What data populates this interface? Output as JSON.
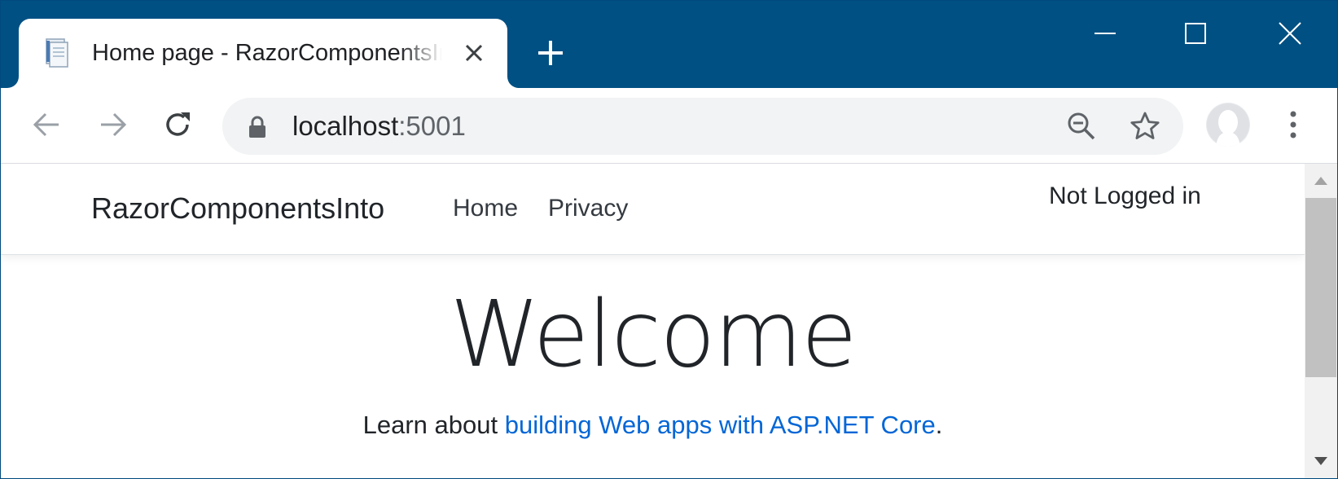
{
  "window": {
    "tab_title": "Home page - RazorComponentsInto",
    "controls": {
      "minimize": "minimize-icon",
      "maximize": "maximize-icon",
      "close": "close-icon"
    }
  },
  "toolbar": {
    "url_host": "localhost",
    "url_port": ":5001",
    "icons": [
      "back-icon",
      "forward-icon",
      "reload-icon",
      "lock-icon",
      "zoom-out-icon",
      "bookmark-star-icon",
      "profile-avatar",
      "menu-icon"
    ]
  },
  "page": {
    "brand": "RazorComponentsInto",
    "nav": {
      "home": "Home",
      "privacy": "Privacy"
    },
    "login_status": "Not Logged in",
    "heading": "Welcome",
    "learn_prefix": "Learn about ",
    "learn_link": "building Web apps with ASP.NET Core",
    "learn_suffix": "."
  },
  "colors": {
    "titlebar": "#005083",
    "link": "#0366d6",
    "text": "#212529"
  }
}
